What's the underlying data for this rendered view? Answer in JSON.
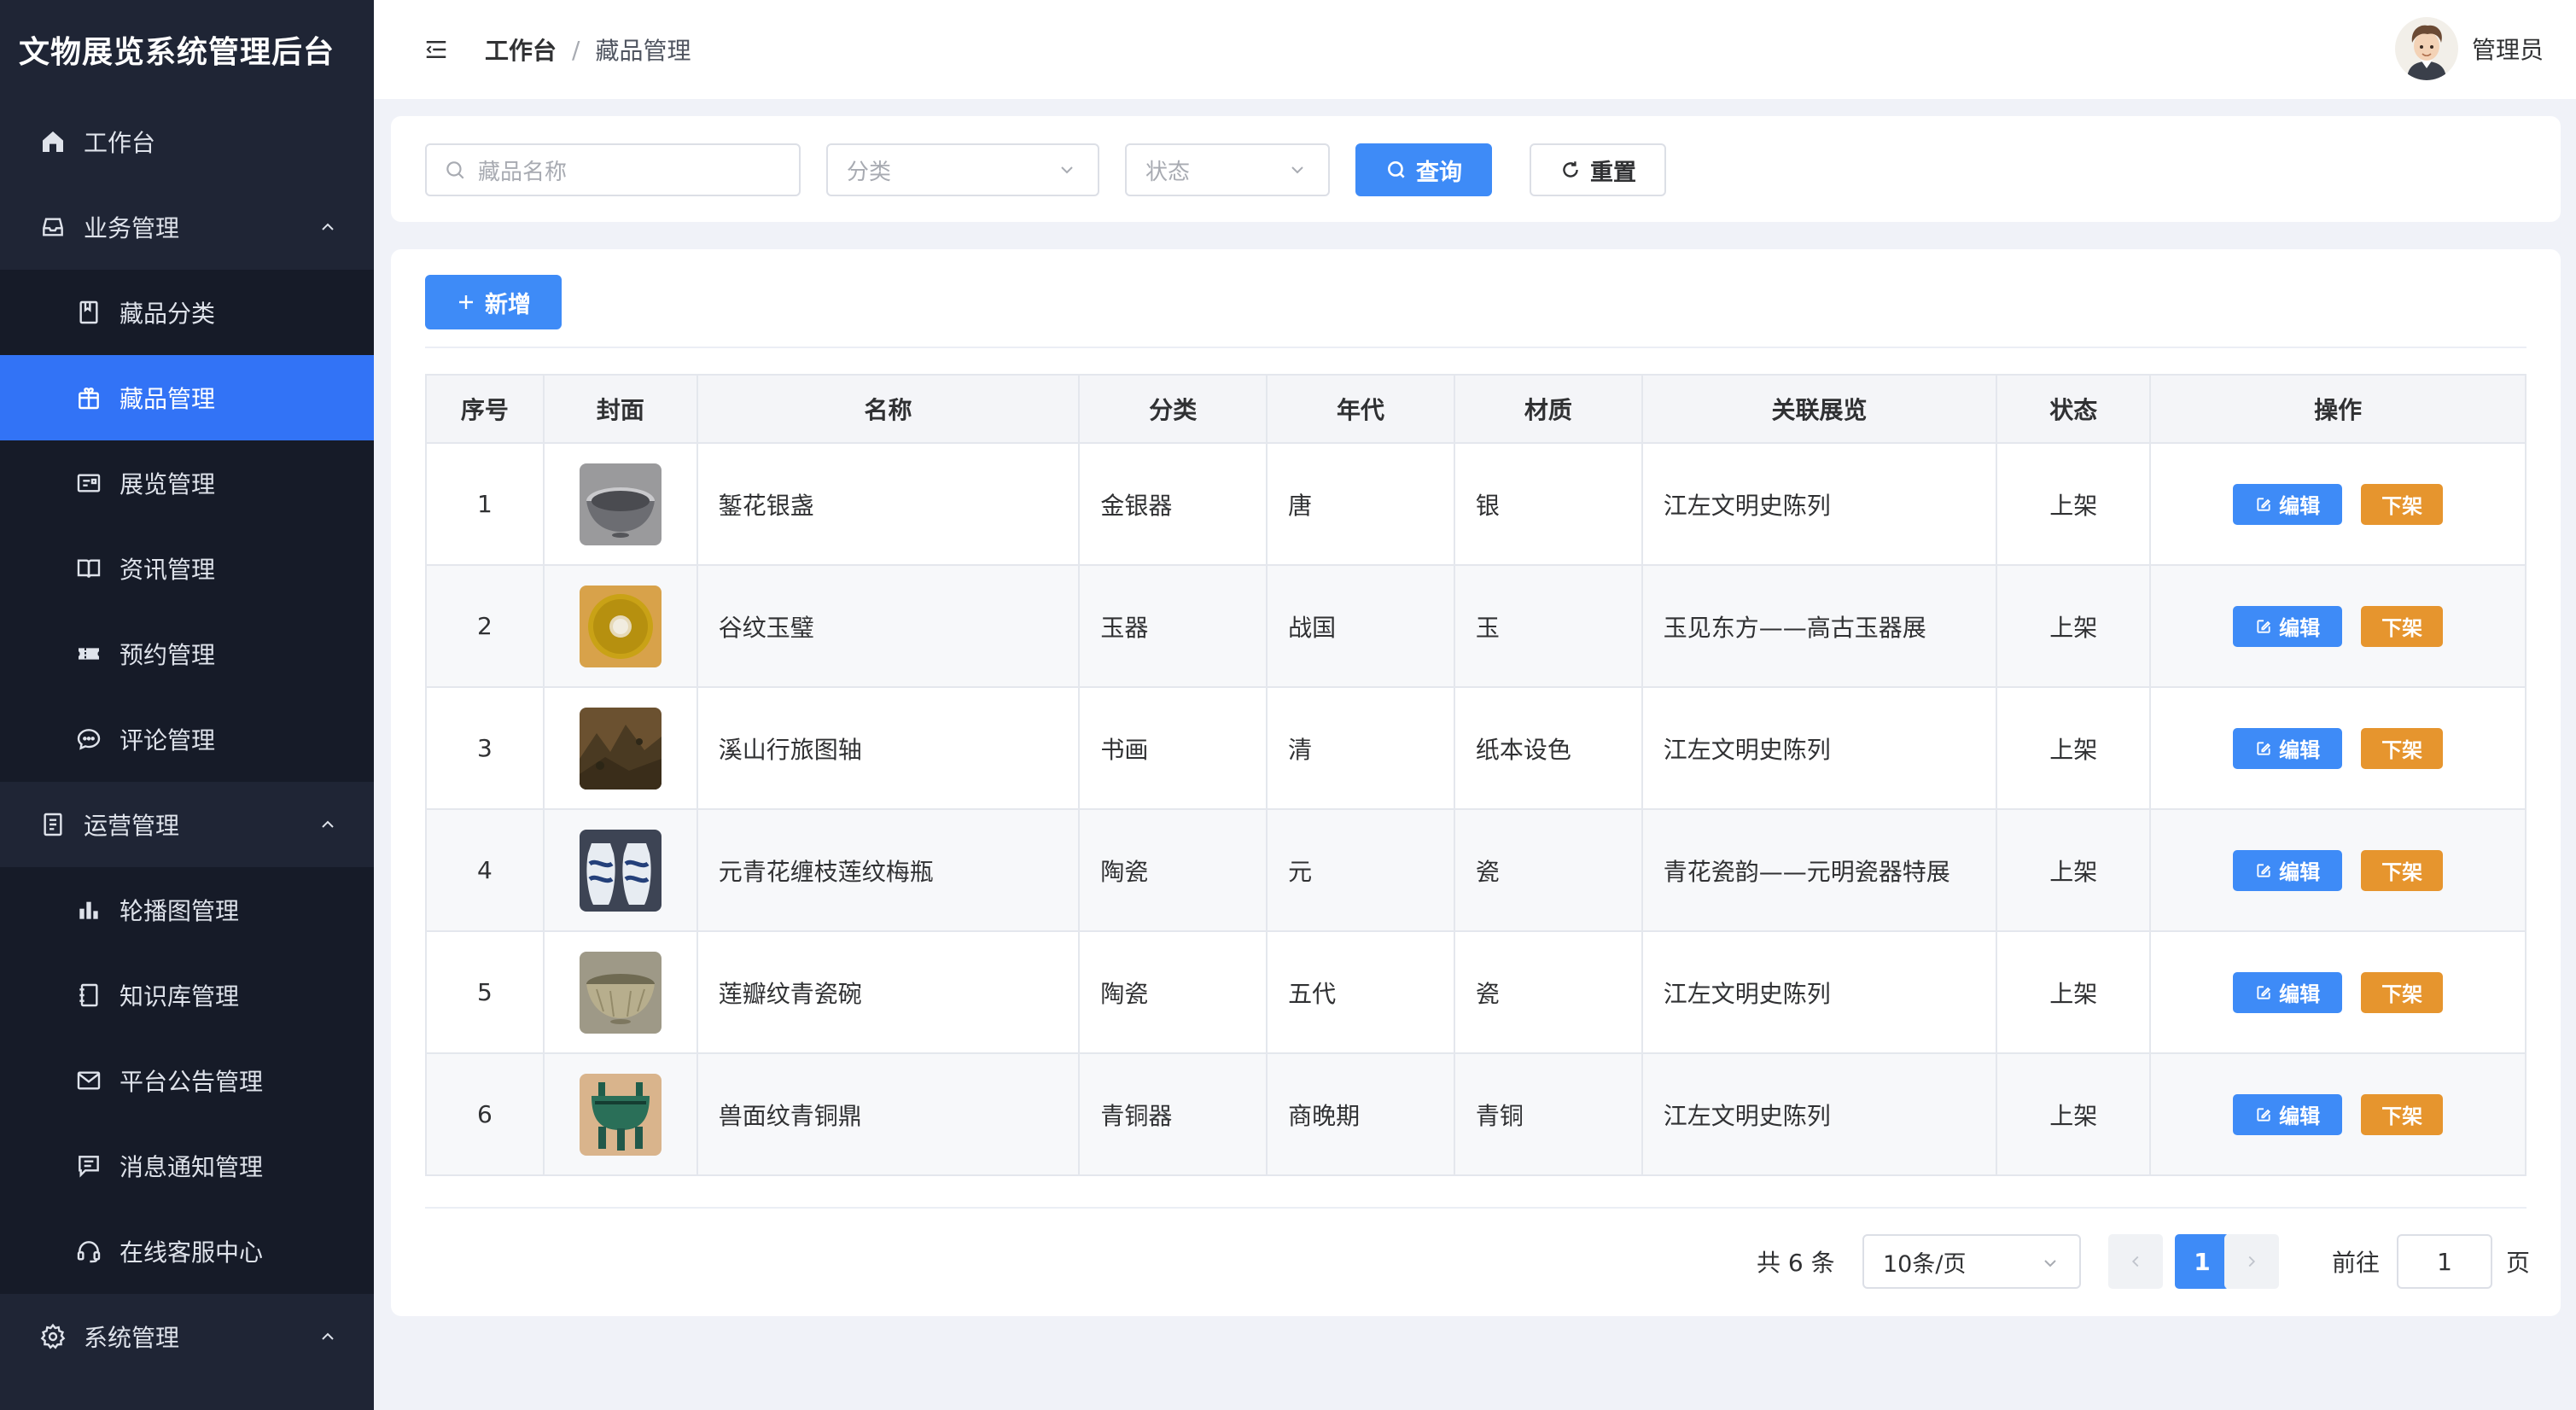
{
  "app": {
    "title": "文物展览系统管理后台"
  },
  "sidebar": {
    "items": [
      {
        "label": "工作台",
        "icon": "home-icon",
        "level": "top"
      },
      {
        "label": "业务管理",
        "icon": "inbox-icon",
        "level": "top",
        "expanded": true
      },
      {
        "label": "藏品分类",
        "icon": "book-icon",
        "level": "sub"
      },
      {
        "label": "藏品管理",
        "icon": "gift-icon",
        "level": "sub",
        "active": true
      },
      {
        "label": "展览管理",
        "icon": "postcard-icon",
        "level": "sub"
      },
      {
        "label": "资讯管理",
        "icon": "reading-icon",
        "level": "sub"
      },
      {
        "label": "预约管理",
        "icon": "ticket-icon",
        "level": "sub"
      },
      {
        "label": "评论管理",
        "icon": "chat-icon",
        "level": "sub"
      },
      {
        "label": "运营管理",
        "icon": "tickets-icon",
        "level": "top",
        "expanded": true
      },
      {
        "label": "轮播图管理",
        "icon": "histogram-icon",
        "level": "sub"
      },
      {
        "label": "知识库管理",
        "icon": "notebook-icon",
        "level": "sub"
      },
      {
        "label": "平台公告管理",
        "icon": "message-icon",
        "level": "sub"
      },
      {
        "label": "消息通知管理",
        "icon": "comment-icon",
        "level": "sub"
      },
      {
        "label": "在线客服中心",
        "icon": "headset-icon",
        "level": "sub"
      },
      {
        "label": "系统管理",
        "icon": "setting-icon",
        "level": "top",
        "expanded": true
      }
    ]
  },
  "header": {
    "breadcrumb_home": "工作台",
    "breadcrumb_sep": "/",
    "breadcrumb_current": "藏品管理",
    "user_name": "管理员"
  },
  "search": {
    "name_placeholder": "藏品名称",
    "category_placeholder": "分类",
    "status_placeholder": "状态",
    "query_label": "查询",
    "reset_label": "重置"
  },
  "toolbar": {
    "add_label": "新增"
  },
  "table": {
    "columns": [
      "序号",
      "封面",
      "名称",
      "分类",
      "年代",
      "材质",
      "关联展览",
      "状态",
      "操作"
    ],
    "edit_label": "编辑",
    "offline_label": "下架",
    "rows": [
      {
        "no": "1",
        "name": "錾花银盏",
        "category": "金银器",
        "era": "唐",
        "material": "银",
        "exhibition": "江左文明史陈列",
        "status": "上架",
        "cover": "silver-cup-image"
      },
      {
        "no": "2",
        "name": "谷纹玉璧",
        "category": "玉器",
        "era": "战国",
        "material": "玉",
        "exhibition": "玉见东方——高古玉器展",
        "status": "上架",
        "cover": "jade-disc-image"
      },
      {
        "no": "3",
        "name": "溪山行旅图轴",
        "category": "书画",
        "era": "清",
        "material": "纸本设色",
        "exhibition": "江左文明史陈列",
        "status": "上架",
        "cover": "landscape-painting-image"
      },
      {
        "no": "4",
        "name": "元青花缠枝莲纹梅瓶",
        "category": "陶瓷",
        "era": "元",
        "material": "瓷",
        "exhibition": "青花瓷韵——元明瓷器特展",
        "status": "上架",
        "cover": "blue-white-vase-image"
      },
      {
        "no": "5",
        "name": "莲瓣纹青瓷碗",
        "category": "陶瓷",
        "era": "五代",
        "material": "瓷",
        "exhibition": "江左文明史陈列",
        "status": "上架",
        "cover": "celadon-bowl-image"
      },
      {
        "no": "6",
        "name": "兽面纹青铜鼎",
        "category": "青铜器",
        "era": "商晚期",
        "material": "青铜",
        "exhibition": "江左文明史陈列",
        "status": "上架",
        "cover": "bronze-ding-image"
      }
    ]
  },
  "pagination": {
    "total": "共 6 条",
    "page_size": "10条/页",
    "current_page": "1",
    "goto_label": "前往",
    "goto_value": "1",
    "page_suffix": "页"
  },
  "colors": {
    "sidebar_bg": "#1f2535",
    "sidebar_sub_bg": "#161b28",
    "active": "#3273f6",
    "primary": "#3e8bf7",
    "warning": "#e6952e",
    "page_bg": "#f0f2f8"
  }
}
